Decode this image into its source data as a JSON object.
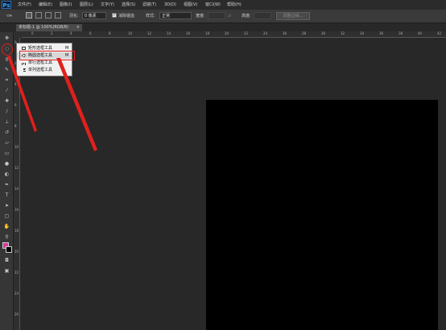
{
  "app": {
    "logo": "Ps"
  },
  "menubar": {
    "items": [
      "文件(F)",
      "编辑(E)",
      "图像(I)",
      "图层(L)",
      "文字(Y)",
      "选择(S)",
      "滤镜(T)",
      "3D(D)",
      "视图(V)",
      "窗口(W)",
      "帮助(H)"
    ]
  },
  "options": {
    "feather_label": "羽化:",
    "feather_value": "0 像素",
    "antialias_label": "消除锯齿",
    "style_label": "样式:",
    "style_value": "正常",
    "width_label": "宽度:",
    "height_label": "高度:",
    "refine_edge_label": "调整边缘..."
  },
  "document": {
    "tab_title": "未标题-1 @ 100%(RGB/8)"
  },
  "ruler": {
    "top_labels": [
      "0",
      "2",
      "4",
      "6",
      "8",
      "10",
      "12",
      "14",
      "16",
      "18",
      "20",
      "22",
      "24",
      "26",
      "28",
      "30",
      "32",
      "34",
      "36",
      "38",
      "40",
      "42"
    ],
    "left_labels": [
      "0",
      "2",
      "4",
      "6",
      "8",
      "10",
      "12",
      "14",
      "16",
      "18",
      "20",
      "22",
      "24",
      "26"
    ]
  },
  "flyout": {
    "items": [
      {
        "label": "矩形选框工具",
        "shortcut": "M"
      },
      {
        "label": "椭圆选框工具",
        "shortcut": "M"
      },
      {
        "label": "单行选框工具",
        "shortcut": ""
      },
      {
        "label": "单列选框工具",
        "shortcut": ""
      }
    ]
  },
  "colors": {
    "foreground": "#d63a9a",
    "background": "#000000",
    "annotation": "#e0201c"
  },
  "toolbox": {
    "icons": [
      "move-icon",
      "marquee-icon",
      "lasso-icon",
      "quick-select-icon",
      "crop-icon",
      "eyedropper-icon",
      "healing-icon",
      "brush-icon",
      "stamp-icon",
      "history-brush-icon",
      "eraser-icon",
      "gradient-icon",
      "blur-icon",
      "dodge-icon",
      "pen-icon",
      "type-icon",
      "path-select-icon",
      "shape-icon",
      "hand-icon",
      "zoom-icon"
    ]
  }
}
